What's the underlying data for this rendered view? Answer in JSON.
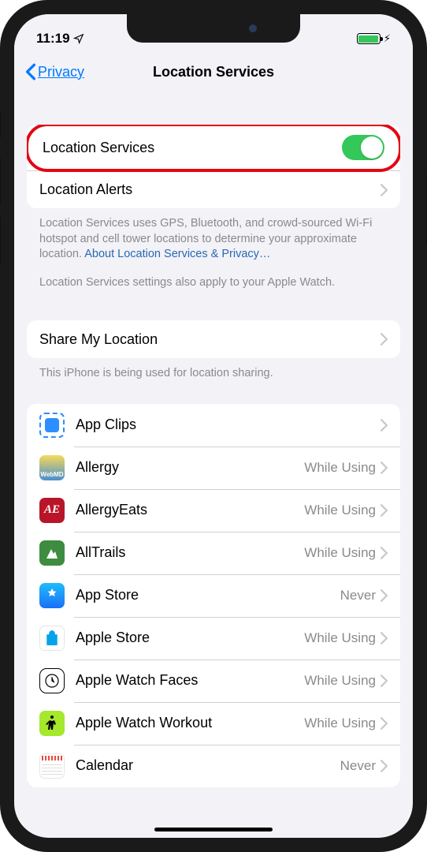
{
  "statusBar": {
    "time": "11:19",
    "charging": "⚡︎"
  },
  "nav": {
    "back": "Privacy",
    "title": "Location Services"
  },
  "primary": {
    "locationServices": "Location Services",
    "locationAlerts": "Location Alerts"
  },
  "footer1a": "Location Services uses GPS, Bluetooth, and crowd-sourced Wi-Fi hotspot and cell tower locations to determine your approximate location. ",
  "footer1b": "About Location Services & Privacy…",
  "footer2": "Location Services settings also apply to your Apple Watch.",
  "share": {
    "label": "Share My Location",
    "footer": "This iPhone is being used for location sharing."
  },
  "apps": [
    {
      "name": "App Clips",
      "status": ""
    },
    {
      "name": "Allergy",
      "status": "While Using"
    },
    {
      "name": "AllergyEats",
      "status": "While Using"
    },
    {
      "name": "AllTrails",
      "status": "While Using"
    },
    {
      "name": "App Store",
      "status": "Never"
    },
    {
      "name": "Apple Store",
      "status": "While Using"
    },
    {
      "name": "Apple Watch Faces",
      "status": "While Using"
    },
    {
      "name": "Apple Watch Workout",
      "status": "While Using"
    },
    {
      "name": "Calendar",
      "status": "Never"
    }
  ]
}
